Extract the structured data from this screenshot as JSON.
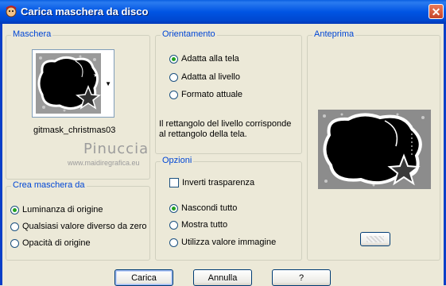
{
  "window": {
    "title": "Carica maschera da disco"
  },
  "maschera": {
    "legend": "Maschera",
    "name": "gitmask_christmas03"
  },
  "orientamento": {
    "legend": "Orientamento",
    "options": [
      "Adatta alla tela",
      "Adatta al livello",
      "Formato attuale"
    ],
    "selected": 0,
    "info": "Il rettangolo del livello corrisponde al rettangolo della tela."
  },
  "opzioni": {
    "legend": "Opzioni",
    "checkbox_label": "Inverti trasparenza",
    "checkbox_checked": false,
    "options": [
      "Nascondi tutto",
      "Mostra tutto",
      "Utilizza valore immagine"
    ],
    "selected": 0
  },
  "crea": {
    "legend": "Crea maschera da",
    "options": [
      "Luminanza di origine",
      "Qualsiasi valore diverso da zero",
      "Opacità di origine"
    ],
    "selected": 0
  },
  "anteprima": {
    "legend": "Anteprima"
  },
  "watermark": {
    "name": "Pinuccia",
    "url": "www.maidiregrafica.eu"
  },
  "buttons": {
    "load": "Carica",
    "cancel": "Annulla",
    "help": "?"
  },
  "colors": {
    "title_bar": "#0054E3",
    "group_legend": "#0046D5",
    "radio_dot": "#21A121"
  }
}
